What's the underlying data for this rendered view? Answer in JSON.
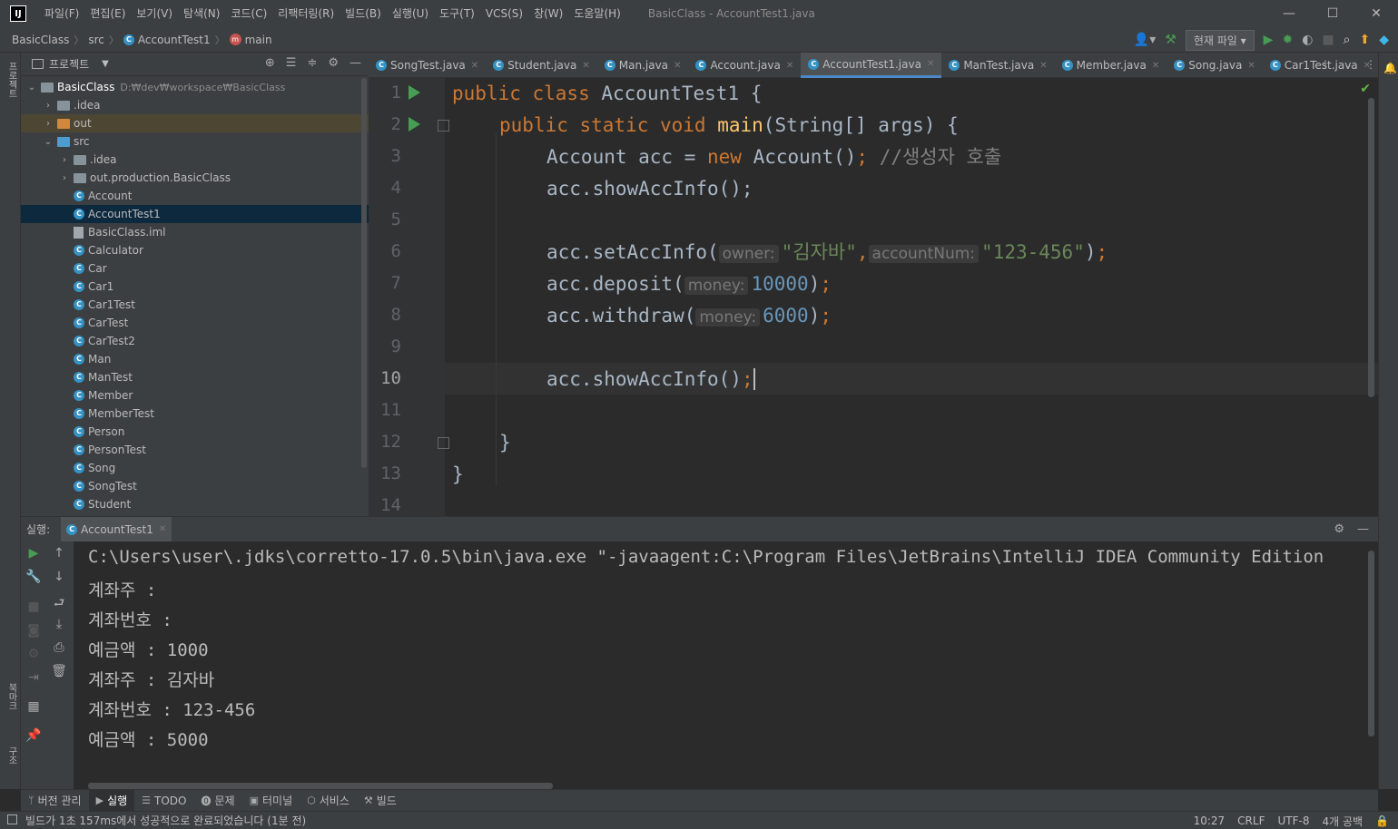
{
  "titlebar": {
    "logo": "IJ",
    "menus": [
      "파일(F)",
      "편집(E)",
      "보기(V)",
      "탐색(N)",
      "코드(C)",
      "리팩터링(R)",
      "빌드(B)",
      "실행(U)",
      "도구(T)",
      "VCS(S)",
      "창(W)",
      "도움말(H)"
    ],
    "window_title": "BasicClass - AccountTest1.java",
    "controls": [
      "—",
      "☐",
      "✕"
    ]
  },
  "navbar": {
    "breadcrumb": [
      "BasicClass",
      "src",
      "AccountTest1",
      "main"
    ],
    "run_config": "현재 파일"
  },
  "left_strip": {
    "project_label": "프로젝트",
    "bookmarks_label": "북마크",
    "structure_label": "구조"
  },
  "project_panel": {
    "title": "프로젝트",
    "root": {
      "name": "BasicClass",
      "path": "D:₩dev₩workspace₩BasicClass"
    },
    "items": [
      {
        "label": ".idea",
        "type": "folder",
        "indent": 1,
        "arrow": "›"
      },
      {
        "label": "out",
        "type": "folder-orange",
        "indent": 1,
        "arrow": "›"
      },
      {
        "label": "src",
        "type": "folder-blue",
        "indent": 1,
        "arrow": "⌄"
      },
      {
        "label": ".idea",
        "type": "folder",
        "indent": 2,
        "arrow": "›"
      },
      {
        "label": "out.production.BasicClass",
        "type": "folder",
        "indent": 2,
        "arrow": "›"
      },
      {
        "label": "Account",
        "type": "class",
        "indent": 2
      },
      {
        "label": "AccountTest1",
        "type": "class-main",
        "indent": 2
      },
      {
        "label": "BasicClass.iml",
        "type": "file",
        "indent": 2
      },
      {
        "label": "Calculator",
        "type": "class",
        "indent": 2
      },
      {
        "label": "Car",
        "type": "class",
        "indent": 2
      },
      {
        "label": "Car1",
        "type": "class",
        "indent": 2
      },
      {
        "label": "Car1Test",
        "type": "class-main",
        "indent": 2
      },
      {
        "label": "CarTest",
        "type": "class-main",
        "indent": 2
      },
      {
        "label": "CarTest2",
        "type": "class-main",
        "indent": 2
      },
      {
        "label": "Man",
        "type": "class",
        "indent": 2
      },
      {
        "label": "ManTest",
        "type": "class-main",
        "indent": 2
      },
      {
        "label": "Member",
        "type": "class",
        "indent": 2
      },
      {
        "label": "MemberTest",
        "type": "class-main",
        "indent": 2
      },
      {
        "label": "Person",
        "type": "class",
        "indent": 2
      },
      {
        "label": "PersonTest",
        "type": "class-main",
        "indent": 2
      },
      {
        "label": "Song",
        "type": "class",
        "indent": 2
      },
      {
        "label": "SongTest",
        "type": "class-main",
        "indent": 2
      },
      {
        "label": "Student",
        "type": "class",
        "indent": 2
      }
    ],
    "selected": "AccountTest1"
  },
  "editor_tabs": [
    {
      "label": "SongTest.java",
      "active": false
    },
    {
      "label": "Student.java",
      "active": false
    },
    {
      "label": "Man.java",
      "active": false
    },
    {
      "label": "Account.java",
      "active": false
    },
    {
      "label": "AccountTest1.java",
      "active": true
    },
    {
      "label": "ManTest.java",
      "active": false
    },
    {
      "label": "Member.java",
      "active": false
    },
    {
      "label": "Song.java",
      "active": false
    },
    {
      "label": "Car1Test.java",
      "active": false
    }
  ],
  "editor": {
    "line_numbers": [
      "1",
      "2",
      "3",
      "4",
      "5",
      "6",
      "7",
      "8",
      "9",
      "10",
      "11",
      "12",
      "13",
      "14"
    ],
    "current_line": "10",
    "code": {
      "l1_kw": "public class ",
      "l1_name": "AccountTest1 {",
      "l2_kw": "public static void ",
      "l2_fn": "main",
      "l2_rest": "(String[] args) {",
      "l3_a": "Account acc = ",
      "l3_kw": "new ",
      "l3_b": "Account()",
      "l3_semi": ";",
      "l3_cmt": " //생성자 호출",
      "l4": "acc.showAccInfo();",
      "l6_a": "acc.setAccInfo(",
      "l6_h1": "owner:",
      "l6_s1": "\"김자바\"",
      "l6_c": ",",
      "l6_h2": "accountNum:",
      "l6_s2": "\"123-456\"",
      "l6_e": ")",
      "l6_semi": ";",
      "l7_a": "acc.deposit(",
      "l7_h": "money:",
      "l7_n": "10000",
      "l7_e": ")",
      "l7_semi": ";",
      "l8_a": "acc.withdraw(",
      "l8_h": "money:",
      "l8_n": "6000",
      "l8_e": ")",
      "l8_semi": ";",
      "l10": "acc.showAccInfo()",
      "l10_semi": ";",
      "l12": "}",
      "l13": "}"
    }
  },
  "run_panel": {
    "label": "실행:",
    "tab": "AccountTest1",
    "console": [
      "C:\\Users\\user\\.jdks\\corretto-17.0.5\\bin\\java.exe \"-javaagent:C:\\Program Files\\JetBrains\\IntelliJ IDEA Community Edition",
      "계좌주 :",
      "계좌번호 :",
      "예금액 : 1000",
      "계좌주 : 김자바",
      "계좌번호 : 123-456",
      "예금액 : 5000"
    ]
  },
  "bottom_tools": [
    {
      "label": "버전 관리",
      "icon": "branch-icon",
      "glyph": "ᛘ",
      "active": false
    },
    {
      "label": "실행",
      "icon": "run-icon",
      "glyph": "▶",
      "active": true
    },
    {
      "label": "TODO",
      "icon": "list-icon",
      "glyph": "☰",
      "active": false
    },
    {
      "label": "문제",
      "icon": "problems-icon",
      "glyph": "⓿",
      "active": false
    },
    {
      "label": "터미널",
      "icon": "terminal-icon",
      "glyph": "▣",
      "active": false
    },
    {
      "label": "서비스",
      "icon": "services-icon",
      "glyph": "⬡",
      "active": false
    },
    {
      "label": "빌드",
      "icon": "hammer-icon",
      "glyph": "⚒",
      "active": false
    }
  ],
  "statusbar": {
    "message": "빌드가 1초 157ms에서 성공적으로 완료되었습니다 (1분 전)",
    "position": "10:27",
    "line_sep": "CRLF",
    "encoding": "UTF-8",
    "indent": "4개 공백"
  },
  "colors": {
    "accent": "#4a88c7",
    "keyword": "#cc7832",
    "string": "#6a8759",
    "number": "#6897bb",
    "method": "#ffc66d",
    "run_green": "#499c54",
    "selected_row": "#0d293e"
  }
}
